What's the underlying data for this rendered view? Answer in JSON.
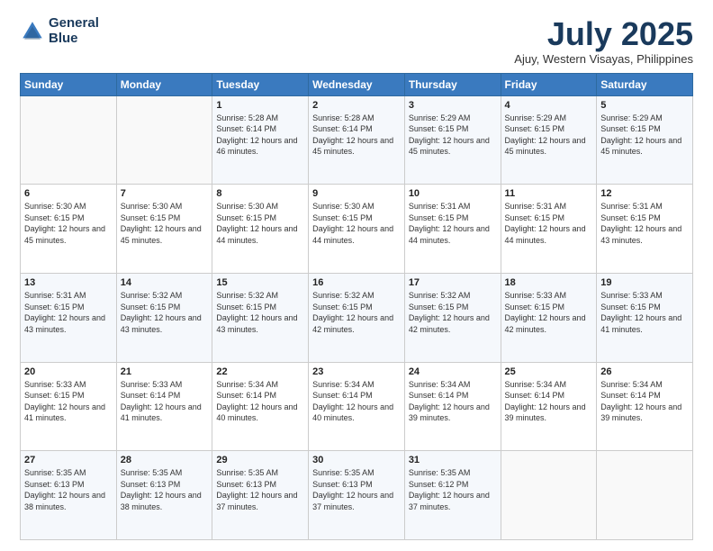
{
  "header": {
    "logo_line1": "General",
    "logo_line2": "Blue",
    "month_title": "July 2025",
    "subtitle": "Ajuy, Western Visayas, Philippines"
  },
  "weekdays": [
    "Sunday",
    "Monday",
    "Tuesday",
    "Wednesday",
    "Thursday",
    "Friday",
    "Saturday"
  ],
  "weeks": [
    [
      {
        "day": "",
        "info": ""
      },
      {
        "day": "",
        "info": ""
      },
      {
        "day": "1",
        "info": "Sunrise: 5:28 AM\nSunset: 6:14 PM\nDaylight: 12 hours and 46 minutes."
      },
      {
        "day": "2",
        "info": "Sunrise: 5:28 AM\nSunset: 6:14 PM\nDaylight: 12 hours and 45 minutes."
      },
      {
        "day": "3",
        "info": "Sunrise: 5:29 AM\nSunset: 6:15 PM\nDaylight: 12 hours and 45 minutes."
      },
      {
        "day": "4",
        "info": "Sunrise: 5:29 AM\nSunset: 6:15 PM\nDaylight: 12 hours and 45 minutes."
      },
      {
        "day": "5",
        "info": "Sunrise: 5:29 AM\nSunset: 6:15 PM\nDaylight: 12 hours and 45 minutes."
      }
    ],
    [
      {
        "day": "6",
        "info": "Sunrise: 5:30 AM\nSunset: 6:15 PM\nDaylight: 12 hours and 45 minutes."
      },
      {
        "day": "7",
        "info": "Sunrise: 5:30 AM\nSunset: 6:15 PM\nDaylight: 12 hours and 45 minutes."
      },
      {
        "day": "8",
        "info": "Sunrise: 5:30 AM\nSunset: 6:15 PM\nDaylight: 12 hours and 44 minutes."
      },
      {
        "day": "9",
        "info": "Sunrise: 5:30 AM\nSunset: 6:15 PM\nDaylight: 12 hours and 44 minutes."
      },
      {
        "day": "10",
        "info": "Sunrise: 5:31 AM\nSunset: 6:15 PM\nDaylight: 12 hours and 44 minutes."
      },
      {
        "day": "11",
        "info": "Sunrise: 5:31 AM\nSunset: 6:15 PM\nDaylight: 12 hours and 44 minutes."
      },
      {
        "day": "12",
        "info": "Sunrise: 5:31 AM\nSunset: 6:15 PM\nDaylight: 12 hours and 43 minutes."
      }
    ],
    [
      {
        "day": "13",
        "info": "Sunrise: 5:31 AM\nSunset: 6:15 PM\nDaylight: 12 hours and 43 minutes."
      },
      {
        "day": "14",
        "info": "Sunrise: 5:32 AM\nSunset: 6:15 PM\nDaylight: 12 hours and 43 minutes."
      },
      {
        "day": "15",
        "info": "Sunrise: 5:32 AM\nSunset: 6:15 PM\nDaylight: 12 hours and 43 minutes."
      },
      {
        "day": "16",
        "info": "Sunrise: 5:32 AM\nSunset: 6:15 PM\nDaylight: 12 hours and 42 minutes."
      },
      {
        "day": "17",
        "info": "Sunrise: 5:32 AM\nSunset: 6:15 PM\nDaylight: 12 hours and 42 minutes."
      },
      {
        "day": "18",
        "info": "Sunrise: 5:33 AM\nSunset: 6:15 PM\nDaylight: 12 hours and 42 minutes."
      },
      {
        "day": "19",
        "info": "Sunrise: 5:33 AM\nSunset: 6:15 PM\nDaylight: 12 hours and 41 minutes."
      }
    ],
    [
      {
        "day": "20",
        "info": "Sunrise: 5:33 AM\nSunset: 6:15 PM\nDaylight: 12 hours and 41 minutes."
      },
      {
        "day": "21",
        "info": "Sunrise: 5:33 AM\nSunset: 6:14 PM\nDaylight: 12 hours and 41 minutes."
      },
      {
        "day": "22",
        "info": "Sunrise: 5:34 AM\nSunset: 6:14 PM\nDaylight: 12 hours and 40 minutes."
      },
      {
        "day": "23",
        "info": "Sunrise: 5:34 AM\nSunset: 6:14 PM\nDaylight: 12 hours and 40 minutes."
      },
      {
        "day": "24",
        "info": "Sunrise: 5:34 AM\nSunset: 6:14 PM\nDaylight: 12 hours and 39 minutes."
      },
      {
        "day": "25",
        "info": "Sunrise: 5:34 AM\nSunset: 6:14 PM\nDaylight: 12 hours and 39 minutes."
      },
      {
        "day": "26",
        "info": "Sunrise: 5:34 AM\nSunset: 6:14 PM\nDaylight: 12 hours and 39 minutes."
      }
    ],
    [
      {
        "day": "27",
        "info": "Sunrise: 5:35 AM\nSunset: 6:13 PM\nDaylight: 12 hours and 38 minutes."
      },
      {
        "day": "28",
        "info": "Sunrise: 5:35 AM\nSunset: 6:13 PM\nDaylight: 12 hours and 38 minutes."
      },
      {
        "day": "29",
        "info": "Sunrise: 5:35 AM\nSunset: 6:13 PM\nDaylight: 12 hours and 37 minutes."
      },
      {
        "day": "30",
        "info": "Sunrise: 5:35 AM\nSunset: 6:13 PM\nDaylight: 12 hours and 37 minutes."
      },
      {
        "day": "31",
        "info": "Sunrise: 5:35 AM\nSunset: 6:12 PM\nDaylight: 12 hours and 37 minutes."
      },
      {
        "day": "",
        "info": ""
      },
      {
        "day": "",
        "info": ""
      }
    ]
  ]
}
